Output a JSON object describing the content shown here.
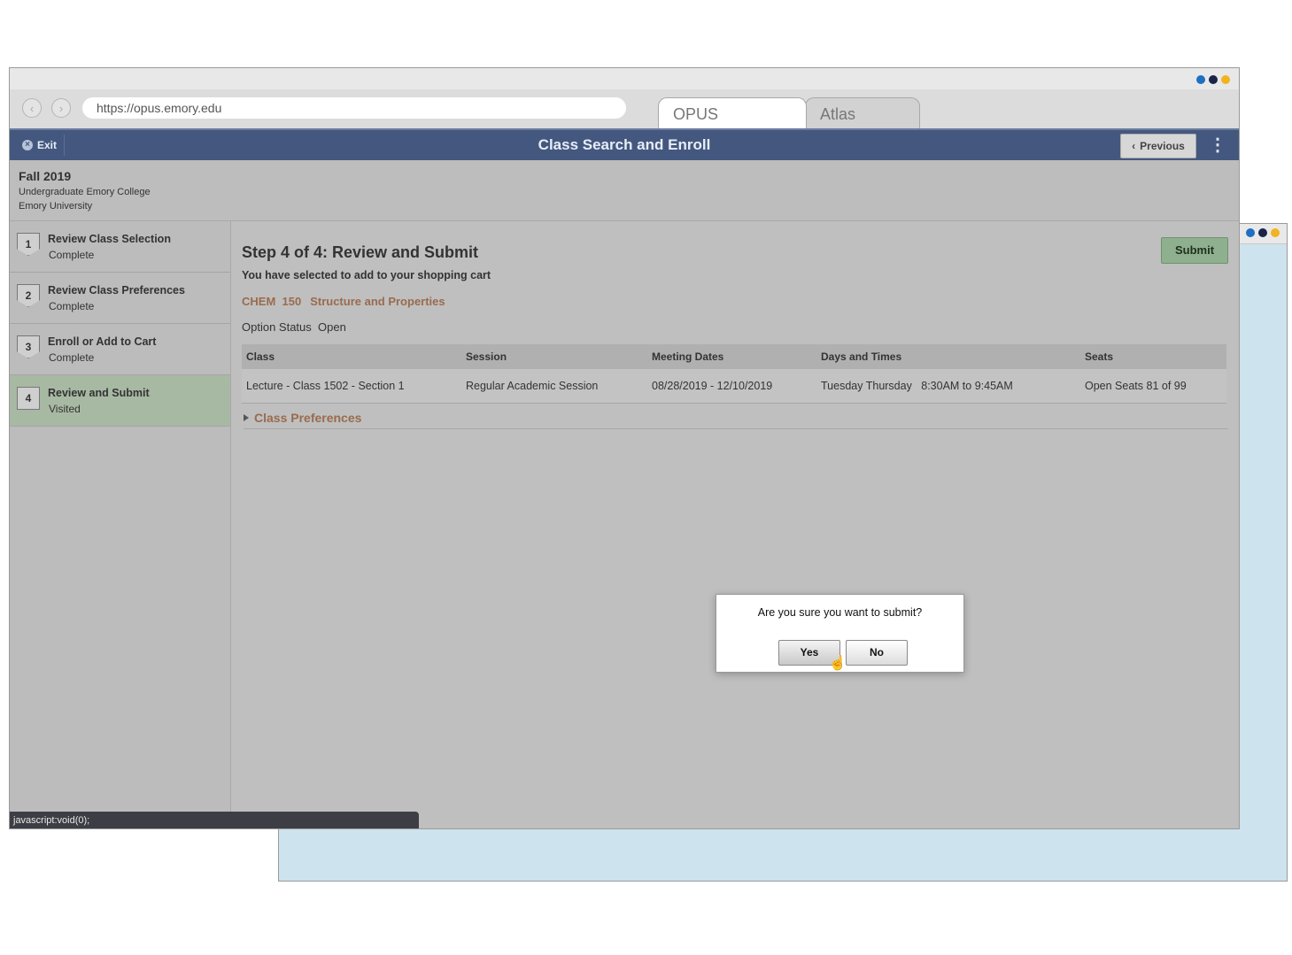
{
  "colors": {
    "dot_blue": "#1f6fc2",
    "dot_navy": "#1a2448",
    "dot_gold": "#f2b320",
    "header_bg": "#44587f",
    "accent_link": "#9a6b4e",
    "submit_green": "#8fb08e",
    "active_step": "#a8b9a3"
  },
  "browser": {
    "url": "https://opus.emory.edu",
    "tabs": [
      {
        "label": "OPUS"
      },
      {
        "label": "Atlas"
      }
    ],
    "back_icon": "chevron-left-icon",
    "forward_icon": "chevron-right-icon"
  },
  "header": {
    "exit_label": "Exit",
    "title": "Class Search and Enroll",
    "previous_label": "Previous"
  },
  "term": {
    "name": "Fall 2019",
    "career": "Undergraduate Emory College",
    "institution": "Emory University"
  },
  "steps": [
    {
      "number": "1",
      "label": "Review Class Selection",
      "status": "Complete"
    },
    {
      "number": "2",
      "label": "Review Class Preferences",
      "status": "Complete"
    },
    {
      "number": "3",
      "label": "Enroll or Add to Cart",
      "status": "Complete"
    },
    {
      "number": "4",
      "label": "Review and Submit",
      "status": "Visited"
    }
  ],
  "main": {
    "step_title": "Step 4 of 4: Review and Submit",
    "cart_message": "You have selected to add to your shopping cart",
    "course_code": "CHEM  150",
    "course_title": "Structure and Properties",
    "option_status_label": "Option Status",
    "option_status_value": "Open",
    "submit_label": "Submit",
    "table": {
      "headers": [
        "Class",
        "Session",
        "Meeting Dates",
        "Days and Times",
        "Seats"
      ],
      "rows": [
        [
          "Lecture - Class 1502 - Section 1",
          "Regular Academic Session",
          "08/28/2019 - 12/10/2019",
          "Tuesday Thursday   8:30AM to 9:45AM",
          "Open Seats 81 of 99"
        ]
      ]
    },
    "class_preferences_label": "Class Preferences"
  },
  "dialog": {
    "message": "Are you sure you want to submit?",
    "yes_label": "Yes",
    "no_label": "No"
  },
  "statusbar": {
    "text": "javascript:void(0);"
  }
}
